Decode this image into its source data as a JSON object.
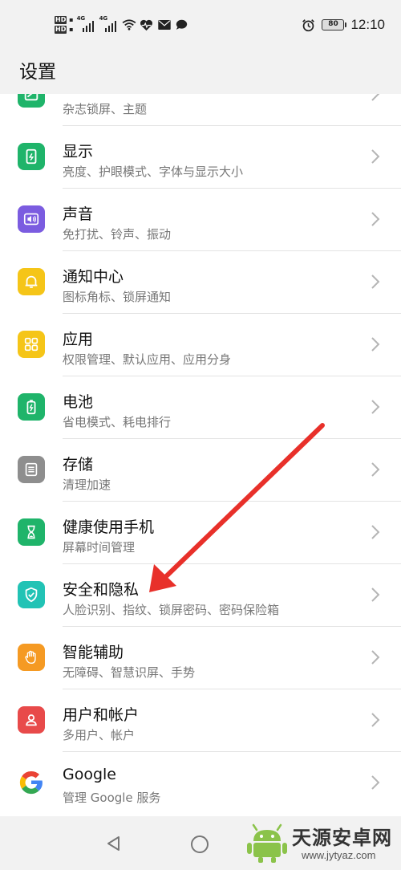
{
  "statusbar": {
    "hd1": "HD",
    "hd2": "HD",
    "net1": "4G",
    "net2": "4G",
    "battery": "80",
    "time": "12:10"
  },
  "header": {
    "title": "设置"
  },
  "list": {
    "partial_subtitle": "杂志锁屏、主题",
    "items": [
      {
        "title": "显示",
        "subtitle": "亮度、护眼模式、字体与显示大小",
        "color": "#1fb46a",
        "icon": "display-icon"
      },
      {
        "title": "声音",
        "subtitle": "免打扰、铃声、振动",
        "color": "#7b5ce0",
        "icon": "speaker-icon"
      },
      {
        "title": "通知中心",
        "subtitle": "图标角标、锁屏通知",
        "color": "#f5c518",
        "icon": "bell-icon"
      },
      {
        "title": "应用",
        "subtitle": "权限管理、默认应用、应用分身",
        "color": "#f5c518",
        "icon": "apps-grid-icon"
      },
      {
        "title": "电池",
        "subtitle": "省电模式、耗电排行",
        "color": "#1fb46a",
        "icon": "battery-icon"
      },
      {
        "title": "存储",
        "subtitle": "清理加速",
        "color": "#8e8e8e",
        "icon": "storage-icon"
      },
      {
        "title": "健康使用手机",
        "subtitle": "屏幕时间管理",
        "color": "#1fb46a",
        "icon": "hourglass-icon"
      },
      {
        "title": "安全和隐私",
        "subtitle": "人脸识别、指纹、锁屏密码、密码保险箱",
        "color": "#22c3b5",
        "icon": "shield-icon"
      },
      {
        "title": "智能辅助",
        "subtitle": "无障碍、智慧识屏、手势",
        "color": "#f59a23",
        "icon": "hand-icon"
      },
      {
        "title": "用户和帐户",
        "subtitle": "多用户、帐户",
        "color": "#e84a4a",
        "icon": "user-icon"
      },
      {
        "title": "Google",
        "subtitle": "管理 Google 服务",
        "color": "#4285f4",
        "icon": "google-icon"
      }
    ]
  },
  "watermark": {
    "name": "天源安卓网",
    "url": "www.jytyaz.com"
  }
}
